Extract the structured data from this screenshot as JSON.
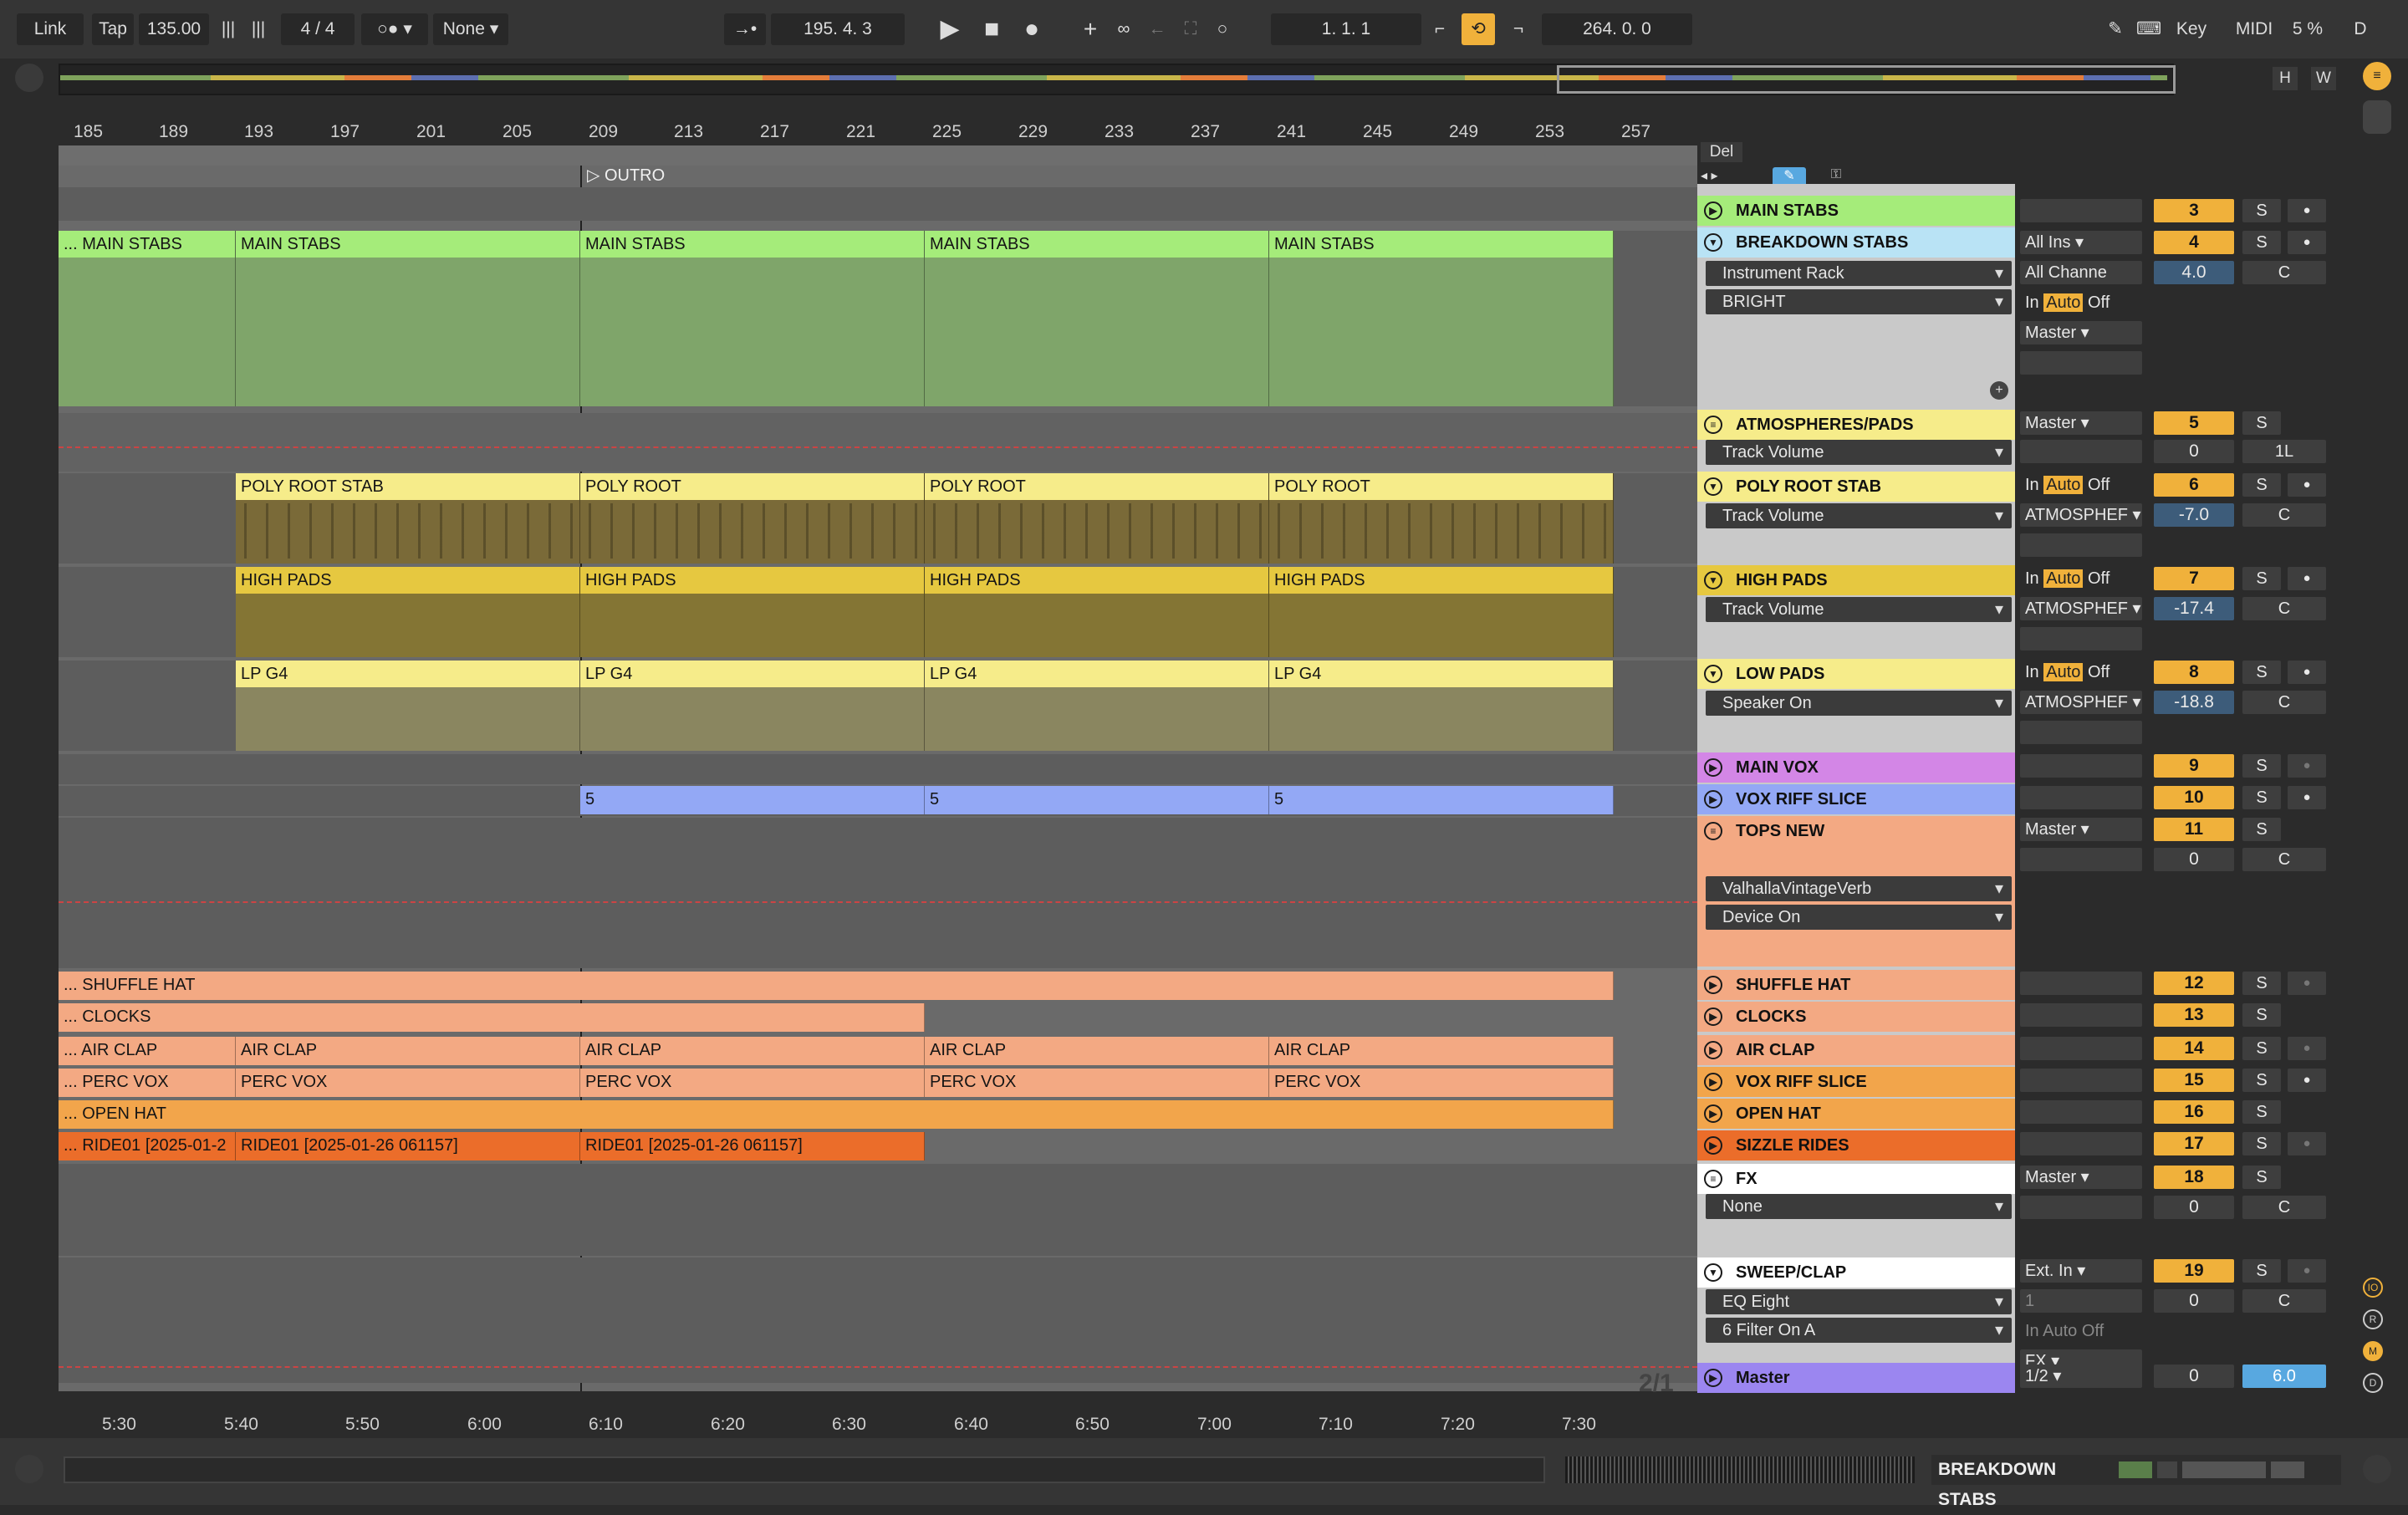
{
  "transport": {
    "link": "Link",
    "tap": "Tap",
    "tempo": "135.00",
    "meter": "4 / 4",
    "quantize": "None",
    "position": "195.   4.   3",
    "loop_start": "1.   1.   1",
    "loop_length": "264.   0.   0",
    "key": "Key",
    "midi": "MIDI",
    "cpu": "5 %",
    "d": "D"
  },
  "overview": {
    "h": "H",
    "w": "W"
  },
  "ruler": [
    "185",
    "189",
    "193",
    "197",
    "201",
    "205",
    "209",
    "213",
    "217",
    "221",
    "225",
    "229",
    "233",
    "237",
    "241",
    "245",
    "249",
    "253",
    "257"
  ],
  "locator": "OUTRO",
  "time_ruler": [
    "5:30",
    "5:40",
    "5:50",
    "6:00",
    "6:10",
    "6:20",
    "6:30",
    "6:40",
    "6:50",
    "7:00",
    "7:10",
    "7:20",
    "7:30"
  ],
  "page_indicator": "2/1",
  "del_label": "Del",
  "lanes": {
    "main_stabs": [
      "... MAIN STABS",
      "MAIN STABS",
      "MAIN STABS",
      "MAIN STABS",
      "MAIN STABS"
    ],
    "poly": [
      "POLY ROOT STAB",
      "POLY ROOT",
      "POLY ROOT",
      "POLY ROOT"
    ],
    "high": [
      "HIGH PADS",
      "HIGH PADS",
      "HIGH PADS",
      "HIGH PADS"
    ],
    "lp": [
      "LP G4",
      "LP G4",
      "LP G4",
      "LP G4"
    ],
    "vox": [
      "5",
      "5",
      "5"
    ],
    "shuffle": "... SHUFFLE HAT",
    "clocks": "... CLOCKS",
    "airclap": [
      "... AIR CLAP",
      "AIR CLAP",
      "AIR CLAP",
      "AIR CLAP",
      "AIR CLAP"
    ],
    "percvox": [
      "... PERC VOX",
      "PERC VOX",
      "PERC VOX",
      "PERC VOX",
      "PERC VOX"
    ],
    "openhat": "... OPEN HAT",
    "ride": [
      "... RIDE01 [2025-01-2",
      "RIDE01 [2025-01-26 061157]",
      "RIDE01 [2025-01-26 061157]"
    ]
  },
  "tracks": [
    {
      "name": "MAIN STABS",
      "num": "3",
      "color": "#a5ec7a"
    },
    {
      "name": "BREAKDOWN STABS",
      "num": "4",
      "color": "#b9e3f5",
      "device1": "Instrument Rack",
      "device2": "BRIGHT",
      "input": "All Ins",
      "channel": "All Channe",
      "output": "Master",
      "vol": "4.0",
      "pan": "C"
    },
    {
      "name": "ATMOSPHERES/PADS",
      "num": "5",
      "color": "#f6ec8a",
      "param": "Track Volume",
      "output": "Master",
      "vol": "0",
      "pan": "1L"
    },
    {
      "name": "POLY ROOT STAB",
      "num": "6",
      "color": "#f6ec8a",
      "param": "Track Volume",
      "output": "ATMOSPHEF",
      "vol": "-7.0",
      "pan": "C"
    },
    {
      "name": "HIGH PADS",
      "num": "7",
      "color": "#e6c840",
      "param": "Track Volume",
      "output": "ATMOSPHEF",
      "vol": "-17.4",
      "pan": "C"
    },
    {
      "name": "LOW PADS",
      "num": "8",
      "color": "#f6ec8a",
      "param": "Speaker On",
      "output": "ATMOSPHEF",
      "vol": "-18.8",
      "pan": "C"
    },
    {
      "name": "MAIN VOX",
      "num": "9",
      "color": "#d386e6"
    },
    {
      "name": "VOX RIFF SLICE",
      "num": "10",
      "color": "#93a8f5"
    },
    {
      "name": "TOPS NEW",
      "num": "11",
      "color": "#f3a983",
      "device1": "ValhallaVintageVerb",
      "device2": "Device On",
      "output": "Master",
      "vol": "0",
      "pan": "C"
    },
    {
      "name": "SHUFFLE HAT",
      "num": "12",
      "color": "#f3a983"
    },
    {
      "name": "CLOCKS",
      "num": "13",
      "color": "#f3a983"
    },
    {
      "name": "AIR CLAP",
      "num": "14",
      "color": "#f3a983"
    },
    {
      "name": "VOX RIFF SLICE",
      "num": "15",
      "color": "#f2a54b"
    },
    {
      "name": "OPEN HAT",
      "num": "16",
      "color": "#f2a54b"
    },
    {
      "name": "SIZZLE RIDES",
      "num": "17",
      "color": "#eb6d2a"
    },
    {
      "name": "FX",
      "num": "18",
      "color": "#ffffff",
      "param": "None",
      "output": "Master",
      "vol": "0",
      "pan": "C"
    },
    {
      "name": "SWEEP/CLAP",
      "num": "19",
      "color": "#ffffff",
      "device1": "EQ Eight",
      "device2": "6 Filter On A",
      "input": "Ext. In",
      "channel": "1",
      "output": "FX",
      "vol": "0",
      "pan": "C"
    },
    {
      "name": "Master",
      "color": "#9b86f0",
      "output": "1/2",
      "vol": "0",
      "pan": "6.0"
    }
  ],
  "labels": {
    "in": "In",
    "auto": "Auto",
    "off": "Off",
    "s": "S"
  },
  "status": {
    "selected_track": "BREAKDOWN STABS"
  }
}
